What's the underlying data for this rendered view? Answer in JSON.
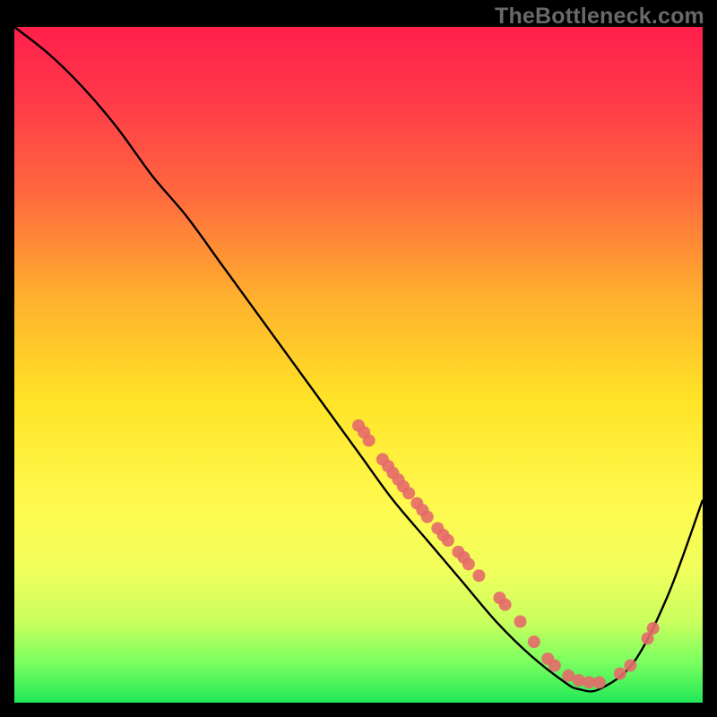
{
  "domain": "Chart",
  "watermark": "TheBottleneck.com",
  "chart_data": {
    "type": "line",
    "title": "",
    "xlabel": "",
    "ylabel": "",
    "xlim": [
      0,
      100
    ],
    "ylim": [
      0,
      100
    ],
    "note": "No axis ticks or numeric labels are rendered in the image; numeric values below are estimated from pixel positions on a 0–100 normalized scale for both axes; background gradient encodes a heat scale from red (top) through yellow to green (bottom).",
    "series": [
      {
        "name": "bottleneck-curve",
        "x": [
          0,
          5,
          10,
          15,
          20,
          25,
          30,
          35,
          40,
          45,
          50,
          55,
          60,
          65,
          70,
          75,
          80,
          82,
          85,
          90,
          95,
          100
        ],
        "y": [
          100,
          96,
          91,
          85,
          78,
          72,
          65,
          58,
          51,
          44,
          37,
          30,
          24,
          18,
          12,
          7,
          3,
          2,
          2,
          6,
          16,
          30
        ]
      }
    ],
    "markers": [
      {
        "x": 50.0,
        "y": 41.0
      },
      {
        "x": 50.8,
        "y": 40.0
      },
      {
        "x": 51.5,
        "y": 38.8
      },
      {
        "x": 53.5,
        "y": 36.0
      },
      {
        "x": 54.3,
        "y": 35.0
      },
      {
        "x": 55.0,
        "y": 34.0
      },
      {
        "x": 55.8,
        "y": 33.0
      },
      {
        "x": 56.5,
        "y": 32.0
      },
      {
        "x": 57.3,
        "y": 31.0
      },
      {
        "x": 58.5,
        "y": 29.5
      },
      {
        "x": 59.3,
        "y": 28.5
      },
      {
        "x": 60.0,
        "y": 27.5
      },
      {
        "x": 61.5,
        "y": 25.8
      },
      {
        "x": 62.3,
        "y": 24.8
      },
      {
        "x": 63.0,
        "y": 24.0
      },
      {
        "x": 64.5,
        "y": 22.3
      },
      {
        "x": 65.3,
        "y": 21.5
      },
      {
        "x": 66.0,
        "y": 20.5
      },
      {
        "x": 67.5,
        "y": 18.8
      },
      {
        "x": 70.5,
        "y": 15.5
      },
      {
        "x": 71.3,
        "y": 14.5
      },
      {
        "x": 73.5,
        "y": 12.0
      },
      {
        "x": 75.5,
        "y": 9.0
      },
      {
        "x": 77.5,
        "y": 6.5
      },
      {
        "x": 78.5,
        "y": 5.5
      },
      {
        "x": 80.5,
        "y": 4.0
      },
      {
        "x": 82.0,
        "y": 3.3
      },
      {
        "x": 83.5,
        "y": 3.0
      },
      {
        "x": 85.0,
        "y": 3.0
      },
      {
        "x": 88.0,
        "y": 4.3
      },
      {
        "x": 89.5,
        "y": 5.5
      },
      {
        "x": 92.0,
        "y": 9.5
      },
      {
        "x": 92.8,
        "y": 11.0
      }
    ],
    "marker_style": {
      "color": "#e66a6a",
      "radius_px": 7
    }
  }
}
